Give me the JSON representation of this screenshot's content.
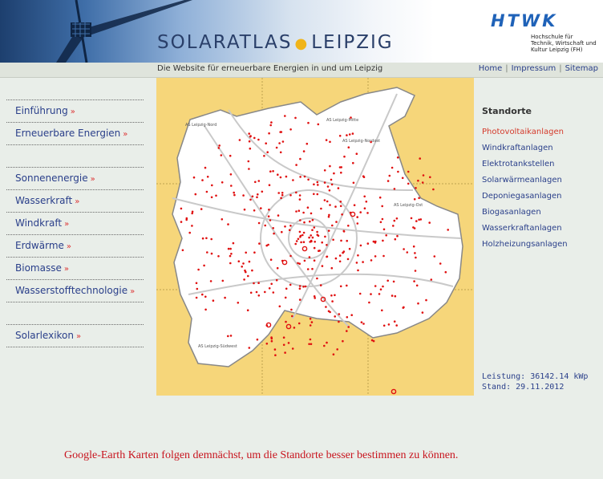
{
  "header": {
    "title_left": "SOLARATLAS",
    "title_right": "LEIPZIG",
    "logo_letters": "HTWK",
    "logo_subtext": "Hochschule für Technik, Wirtschaft und Kultur Leipzig (FH)"
  },
  "subbar": {
    "tagline": "Die Website für erneuerbare Energien in und um Leipzig",
    "nav": [
      "Home",
      "Impressum",
      "Sitemap"
    ]
  },
  "sidebar": {
    "groups": [
      [
        "Einführung",
        "Erneuerbare Energien"
      ],
      [
        "Sonnenenergie",
        "Wasserkraft",
        "Windkraft",
        "Erdwärme",
        "Biomasse",
        "Wasserstofftechnologie"
      ],
      [
        "Solarlexikon"
      ]
    ]
  },
  "map": {
    "district_labels": [
      "AS Leipzig-Nord",
      "AS Leipzig-Mitte",
      "AS Leipzig-Nordost",
      "AS Leipzig-Ost",
      "AS Leipzig-Südwest"
    ]
  },
  "standorte": {
    "title": "Standorte",
    "items": [
      "Photovoltaikanlagen",
      "Windkraftanlagen",
      "Elektrotankstellen",
      "Solarwärmeanlagen",
      "Deponiegasanlagen",
      "Biogasanlagen",
      "Wasserkraftanlagen",
      "Holzheizungsanlagen"
    ],
    "active_index": 0
  },
  "stats": {
    "leistung": "Leistung: 36142.14 kWp",
    "stand": "Stand: 29.11.2012"
  },
  "notice": "Google-Earth Karten folgen demnächst, um die Standorte besser bestimmen zu können.",
  "colors": {
    "link": "#2a3f8a",
    "active": "#d43a2b",
    "map_bg": "#f6d67a",
    "marker": "#e01010"
  }
}
